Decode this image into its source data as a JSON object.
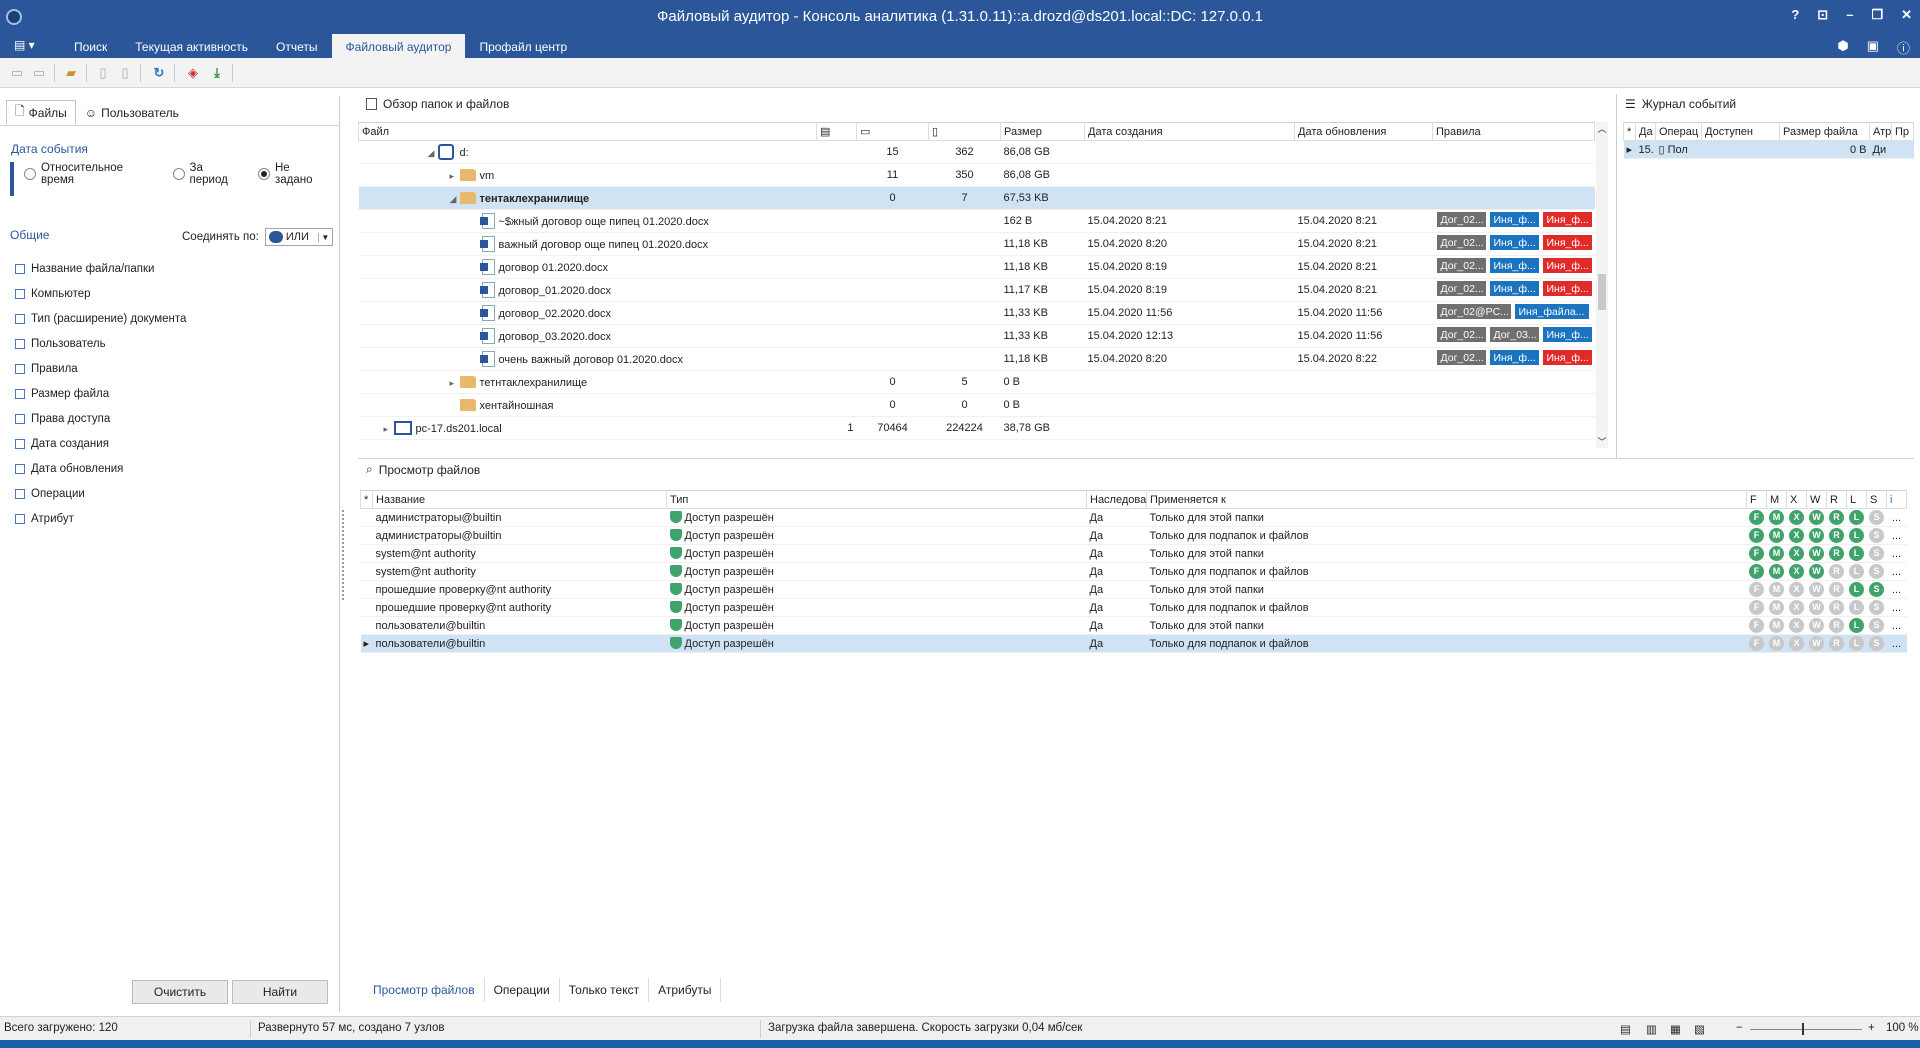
{
  "window": {
    "title": "Файловый аудитор - Консоль аналитика (1.31.0.11)::a.drozd@ds201.local::DC: 127.0.0.1",
    "controls": [
      "?",
      "⊡",
      "–",
      "❐",
      "✕"
    ]
  },
  "ribbon": {
    "menu_label": "▤ ▾",
    "tabs": [
      "Поиск",
      "Текущая активность",
      "Отчеты",
      "Файловый аудитор",
      "Профайл центр"
    ],
    "active_tab": "Файловый аудитор"
  },
  "left": {
    "tabs": [
      "Файлы",
      "Пользователь"
    ],
    "date_section": "Дата события",
    "radios": [
      "Относительное время",
      "За период",
      "Не задано"
    ],
    "radio_selected": "Не задано",
    "common_label": "Общие",
    "join_label": "Соединять по:",
    "join_value": "ИЛИ",
    "filters": [
      "Название файла/папки",
      "Компьютер",
      "Тип (расширение) документа",
      "Пользователь",
      "Правила",
      "Размер файла",
      "Права доступа",
      "Дата создания",
      "Дата обновления",
      "Операции",
      "Атрибут"
    ],
    "clear_btn": "Очистить",
    "find_btn": "Найти"
  },
  "folders": {
    "title": "Обзор папок и файлов",
    "columns": [
      "Файл",
      "",
      "",
      "",
      "Размер",
      "Дата создания",
      "Дата обновления",
      "Правила"
    ],
    "rows": [
      {
        "indent": 3,
        "exp": "◢",
        "icon": "drive",
        "name": "d:",
        "c1": "",
        "c2": "15",
        "c3": "362",
        "size": "86,08 GB",
        "created": "",
        "updated": "",
        "rules": []
      },
      {
        "indent": 4,
        "exp": "▸",
        "icon": "folder",
        "name": "vm",
        "c1": "",
        "c2": "11",
        "c3": "350",
        "size": "86,08 GB",
        "created": "",
        "updated": "",
        "rules": []
      },
      {
        "indent": 4,
        "exp": "◢",
        "icon": "folder",
        "name": "тентаклехранилище",
        "c1": "",
        "c2": "0",
        "c3": "7",
        "size": "67,53 KB",
        "created": "",
        "updated": "",
        "rules": [],
        "selected": true,
        "bold": true
      },
      {
        "indent": 5,
        "exp": "",
        "icon": "doc",
        "name": "~$жный договор още пипец 01.2020.docx",
        "c1": "",
        "c2": "",
        "c3": "",
        "size": "162 B",
        "created": "15.04.2020 8:21",
        "updated": "15.04.2020 8:21",
        "rules": [
          [
            "gray",
            "Дог_02..."
          ],
          [
            "blue",
            "Иня_ф..."
          ],
          [
            "red",
            "Иня_ф..."
          ]
        ]
      },
      {
        "indent": 5,
        "exp": "",
        "icon": "doc",
        "name": "важный договор още пипец 01.2020.docx",
        "c1": "",
        "c2": "",
        "c3": "",
        "size": "11,18 KB",
        "created": "15.04.2020 8:20",
        "updated": "15.04.2020 8:21",
        "rules": [
          [
            "gray",
            "Дог_02..."
          ],
          [
            "blue",
            "Иня_ф..."
          ],
          [
            "red",
            "Иня_ф..."
          ]
        ]
      },
      {
        "indent": 5,
        "exp": "",
        "icon": "doc",
        "name": "договор 01.2020.docx",
        "c1": "",
        "c2": "",
        "c3": "",
        "size": "11,18 KB",
        "created": "15.04.2020 8:19",
        "updated": "15.04.2020 8:21",
        "rules": [
          [
            "gray",
            "Дог_02..."
          ],
          [
            "blue",
            "Иня_ф..."
          ],
          [
            "red",
            "Иня_ф..."
          ]
        ]
      },
      {
        "indent": 5,
        "exp": "",
        "icon": "doc",
        "name": "договор_01.2020.docx",
        "c1": "",
        "c2": "",
        "c3": "",
        "size": "11,17 KB",
        "created": "15.04.2020 8:19",
        "updated": "15.04.2020 8:21",
        "rules": [
          [
            "gray",
            "Дог_02..."
          ],
          [
            "blue",
            "Иня_ф..."
          ],
          [
            "red",
            "Иня_ф..."
          ]
        ]
      },
      {
        "indent": 5,
        "exp": "",
        "icon": "doc",
        "name": "договор_02.2020.docx",
        "c1": "",
        "c2": "",
        "c3": "",
        "size": "11,33 KB",
        "created": "15.04.2020 11:56",
        "updated": "15.04.2020 11:56",
        "rules": [
          [
            "gray wide",
            "Дог_02@PC..."
          ],
          [
            "blue wide",
            "Иня_файла..."
          ]
        ]
      },
      {
        "indent": 5,
        "exp": "",
        "icon": "doc",
        "name": "договор_03.2020.docx",
        "c1": "",
        "c2": "",
        "c3": "",
        "size": "11,33 KB",
        "created": "15.04.2020 12:13",
        "updated": "15.04.2020 11:56",
        "rules": [
          [
            "gray",
            "Дог_02..."
          ],
          [
            "gray",
            "Дог_03..."
          ],
          [
            "blue",
            "Иня_ф..."
          ]
        ]
      },
      {
        "indent": 5,
        "exp": "",
        "icon": "doc",
        "name": "очень важный договор 01.2020.docx",
        "c1": "",
        "c2": "",
        "c3": "",
        "size": "11,18 KB",
        "created": "15.04.2020 8:20",
        "updated": "15.04.2020 8:22",
        "rules": [
          [
            "gray",
            "Дог_02..."
          ],
          [
            "blue",
            "Иня_ф..."
          ],
          [
            "red",
            "Иня_ф..."
          ]
        ]
      },
      {
        "indent": 4,
        "exp": "▸",
        "icon": "folder",
        "name": "тетнтаклехранилище",
        "c1": "",
        "c2": "0",
        "c3": "5",
        "size": "0 B",
        "created": "",
        "updated": "",
        "rules": []
      },
      {
        "indent": 4,
        "exp": "",
        "icon": "folder",
        "name": "хентайношная",
        "c1": "",
        "c2": "0",
        "c3": "0",
        "size": "0 B",
        "created": "",
        "updated": "",
        "rules": []
      },
      {
        "indent": 1,
        "exp": "▸",
        "icon": "pc",
        "name": "pc-17.ds201.local",
        "c1": "1",
        "c2": "70464",
        "c3": "224224",
        "size": "38,78 GB",
        "created": "",
        "updated": "",
        "rules": []
      }
    ]
  },
  "journal": {
    "title": "Журнал событий",
    "columns": [
      "*",
      "Да",
      "Операц",
      "Доступен",
      "Размер файла",
      "Атр",
      "Пр"
    ],
    "row": {
      "date": "15.",
      "op": "Пол",
      "size": "0 B",
      "access": "Ди"
    }
  },
  "files_view": {
    "title": "Просмотр файлов",
    "columns": [
      "*",
      "Название",
      "Тип",
      "Наследова",
      "Применяется к",
      "F",
      "M",
      "X",
      "W",
      "R",
      "L",
      "S",
      "i"
    ],
    "rows": [
      {
        "name": "администраторы@builtin",
        "type": "Доступ разрешён",
        "inherit": "Да",
        "applies": "Только для этой папки",
        "perms": "ggggggl"
      },
      {
        "name": "администраторы@builtin",
        "type": "Доступ разрешён",
        "inherit": "Да",
        "applies": "Только для подпапок и файлов",
        "perms": "ggggggl"
      },
      {
        "name": "system@nt authority",
        "type": "Доступ разрешён",
        "inherit": "Да",
        "applies": "Только для этой папки",
        "perms": "ggggggl"
      },
      {
        "name": "system@nt authority",
        "type": "Доступ разрешён",
        "inherit": "Да",
        "applies": "Только для подпапок и файлов",
        "perms": "ggggllll"
      },
      {
        "name": "прошедшие проверку@nt authority",
        "type": "Доступ разрешён",
        "inherit": "Да",
        "applies": "Только для этой папки",
        "perms": "lllllgg"
      },
      {
        "name": "прошедшие проверку@nt authority",
        "type": "Доступ разрешён",
        "inherit": "Да",
        "applies": "Только для подпапок и файлов",
        "perms": "lllllll"
      },
      {
        "name": "пользователи@builtin",
        "type": "Доступ разрешён",
        "inherit": "Да",
        "applies": "Только для этой папки",
        "perms": "lllllgl"
      },
      {
        "name": "пользователи@builtin",
        "type": "Доступ разрешён",
        "inherit": "Да",
        "applies": "Только для подпапок и файлов",
        "perms": "lllllll",
        "selected": true
      }
    ],
    "more": "..."
  },
  "bottom_tabs": [
    "Просмотр файлов",
    "Операции",
    "Только текст",
    "Атрибуты"
  ],
  "status": {
    "loaded": "Всего загружено: 120",
    "expanded": "Развернуто 57 мс, создано 7 узлов",
    "message": "Загрузка файла завершена. Скорость загрузки 0,04 мб/сек",
    "zoom": "100 %"
  }
}
